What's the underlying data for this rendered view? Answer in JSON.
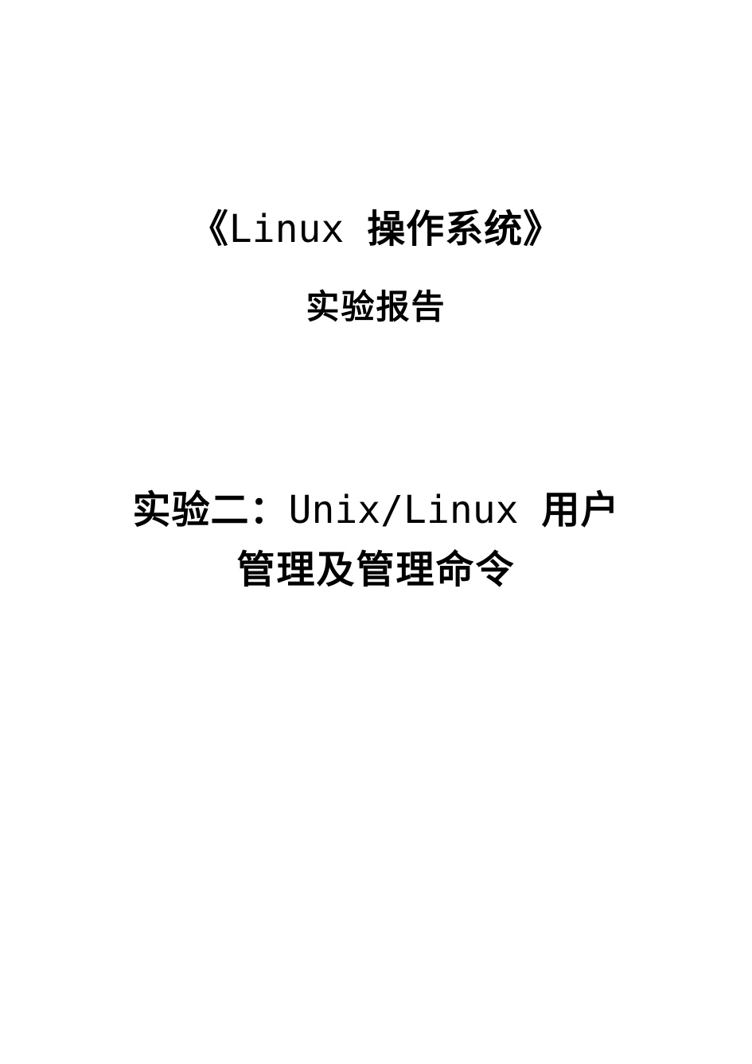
{
  "title": {
    "bracket_open": "《",
    "latin": "Linux ",
    "cjk": "操作系统",
    "bracket_close": "》",
    "subtitle": "实验报告"
  },
  "section": {
    "prefix": "实验二：",
    "latin": "Unix/Linux ",
    "suffix": "用户",
    "line2": "管理及管理命令"
  }
}
